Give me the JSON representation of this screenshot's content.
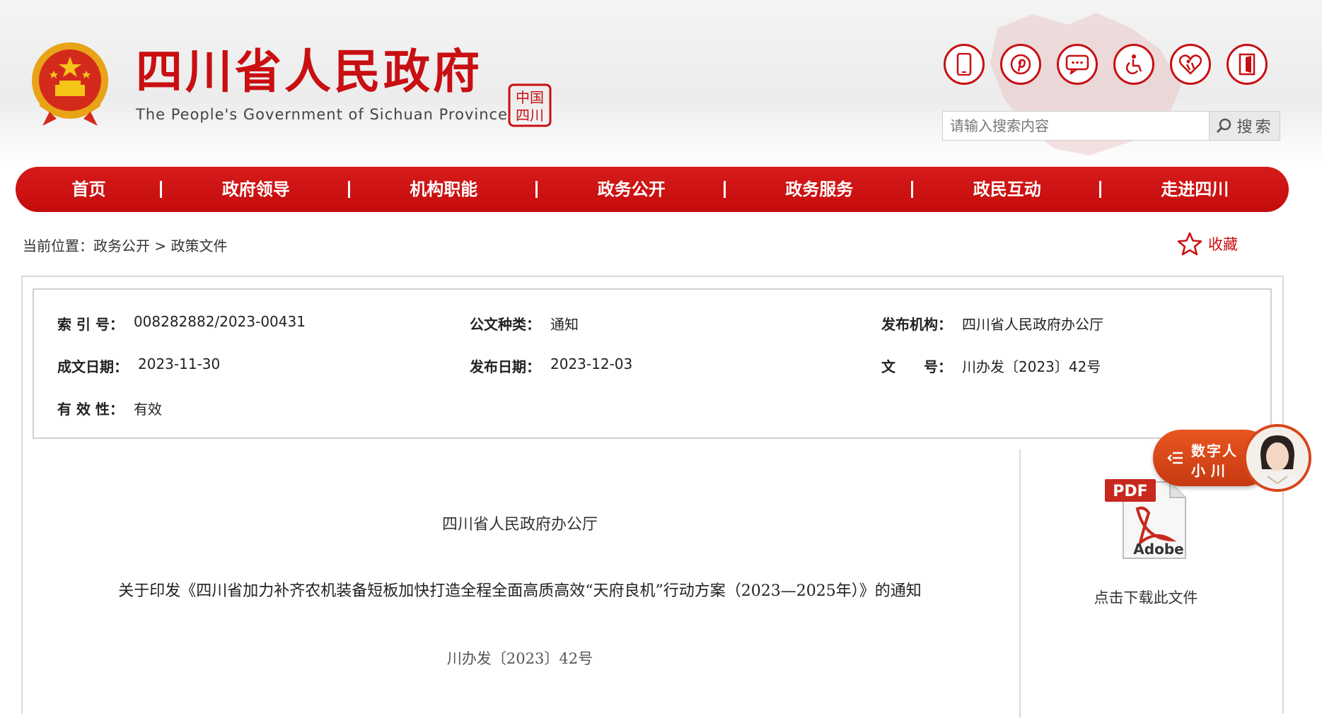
{
  "header": {
    "title": "四川省人民政府",
    "subtitle": "The People's Government of Sichuan Province",
    "seal_text": "中国四川",
    "brand_color": "#c80f12",
    "tool_icons": [
      "mobile-icon",
      "pinterest-icon",
      "message-icon",
      "accessibility-icon",
      "care-icon",
      "exit-icon"
    ],
    "search": {
      "placeholder": "请输入搜索内容",
      "button_label": "搜索"
    }
  },
  "nav": {
    "items": [
      {
        "label": "首页"
      },
      {
        "label": "政府领导"
      },
      {
        "label": "机构职能"
      },
      {
        "label": "政务公开"
      },
      {
        "label": "政务服务"
      },
      {
        "label": "政民互动"
      },
      {
        "label": "走进四川"
      }
    ]
  },
  "breadcrumb": {
    "prefix": "当前位置：",
    "level1": "政务公开",
    "separator": ">",
    "level2": "政策文件"
  },
  "favorite": {
    "label": "收藏"
  },
  "meta": {
    "index_label": "索 引 号：",
    "index_value": "008282882/2023-00431",
    "type_label": "公文种类：",
    "type_value": "通知",
    "issuer_label": "发布机构：",
    "issuer_value": "四川省人民政府办公厅",
    "created_label": "成文日期：",
    "created_value": "2023-11-30",
    "published_label": "发布日期：",
    "published_value": "2023-12-03",
    "docno_label": "文　　号：",
    "docno_value": "川办发〔2023〕42号",
    "validity_label": "有 效 性：",
    "validity_value": "有效"
  },
  "document": {
    "org": "四川省人民政府办公厅",
    "title": "关于印发《四川省加力补齐农机装备短板加快打造全程全面高质高效“天府良机”行动方案（2023—2025年）》的通知",
    "number": "川办发〔2023〕42号"
  },
  "download": {
    "pdf_badge": "PDF",
    "adobe_label": "Adobe",
    "label": "点击下载此文件"
  },
  "assistant": {
    "line1": "数字人",
    "line2": "小川"
  }
}
